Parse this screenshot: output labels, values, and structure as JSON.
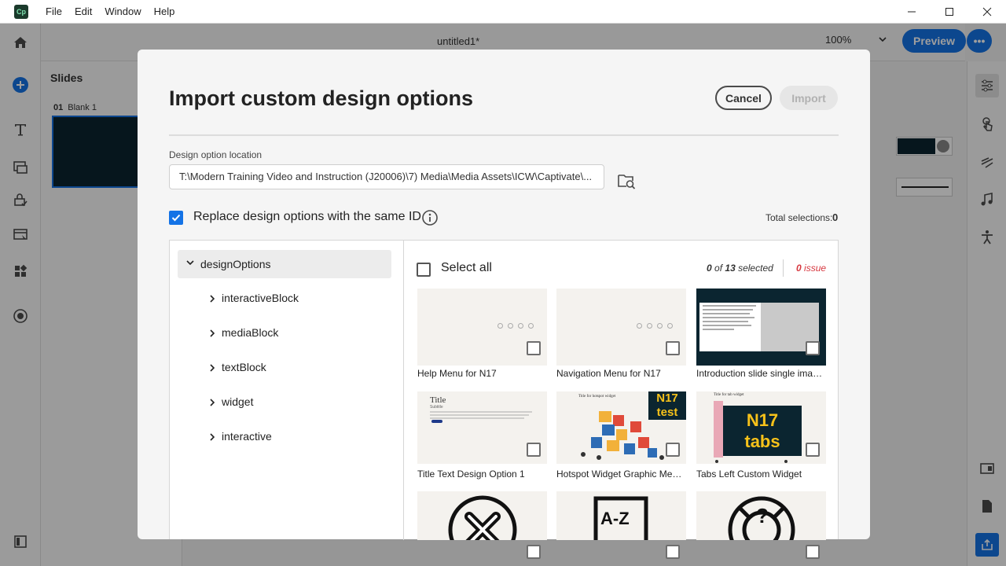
{
  "menubar": {
    "app_logo": "Cp",
    "items": [
      "File",
      "Edit",
      "Window",
      "Help"
    ]
  },
  "window_controls": {
    "minimize": "—",
    "maximize": "☐",
    "close": "✕"
  },
  "toolbar": {
    "doc_title": "untitled1*",
    "zoom": "100%",
    "preview_label": "Preview",
    "more_label": "•••"
  },
  "slides_panel": {
    "title": "Slides",
    "slides": [
      {
        "number": "01",
        "name": "Blank 1"
      }
    ]
  },
  "dialog": {
    "title": "Import custom design options",
    "cancel_label": "Cancel",
    "import_label": "Import",
    "location_label": "Design option location",
    "location_value": "T:\\Modern Training Video and Instruction (J20006)\\7) Media\\Media Assets\\ICW\\Captivate\\...",
    "replace_label": "Replace design options with the same ID",
    "replace_checked": true,
    "total_label": "Total selections:",
    "total_count": "0",
    "tree": {
      "root": "designOptions",
      "children": [
        "interactiveBlock",
        "mediaBlock",
        "textBlock",
        "widget",
        "interactive"
      ]
    },
    "select_all_label": "Select all",
    "selected_count": "0",
    "selected_of": "of",
    "selected_total": "13",
    "selected_word": "selected",
    "issue_count": "0",
    "issue_word": "issue",
    "items": [
      {
        "name": "Help Menu for N17",
        "checked": false
      },
      {
        "name": "Navigation Menu for N17",
        "checked": false
      },
      {
        "name": "Introduction slide single image r...",
        "checked": false
      },
      {
        "name": "Title Text Design Option 1",
        "checked": false,
        "thumb_title": "Title",
        "thumb_subtitle": "Subtitle"
      },
      {
        "name": "Hotspot Widget Graphic Mediu...",
        "checked": false,
        "thumb_title": "Title for hotspot widget",
        "badge": [
          "N17",
          "test"
        ]
      },
      {
        "name": "Tabs Left Custom Widget",
        "checked": false,
        "thumb_title": "Title for tab widget",
        "badge": [
          "N17",
          "tabs"
        ]
      },
      {
        "name": "",
        "checked": false,
        "icon": "close-circle-icon"
      },
      {
        "name": "",
        "checked": false,
        "icon": "glossary-book-icon",
        "icon_text": "A-Z"
      },
      {
        "name": "",
        "checked": false,
        "icon": "help-lifebuoy-icon",
        "icon_text": "?"
      }
    ]
  },
  "colors": {
    "accent": "#1473e6",
    "slide_bg": "#0b2530",
    "badge_bg": "#0b2530",
    "badge_text": "#f7c21a",
    "issue": "#d7373f"
  }
}
